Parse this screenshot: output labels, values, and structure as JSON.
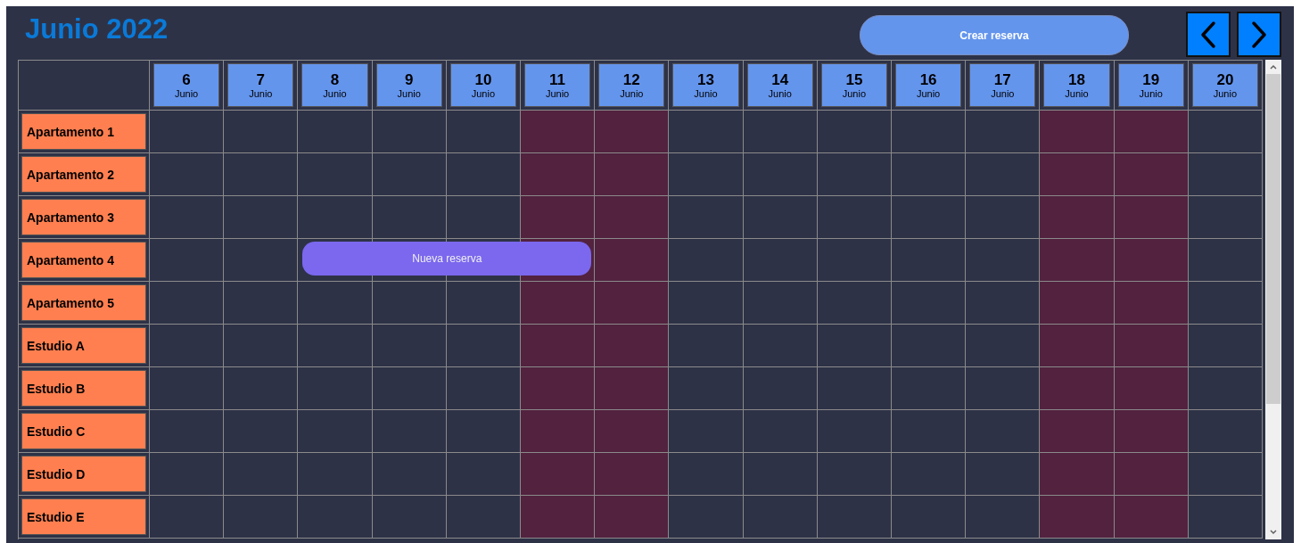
{
  "title": "Junio 2022",
  "create_button": "Crear reserva",
  "days": [
    {
      "day": "6",
      "month": "Junio",
      "weekend": false
    },
    {
      "day": "7",
      "month": "Junio",
      "weekend": false
    },
    {
      "day": "8",
      "month": "Junio",
      "weekend": false
    },
    {
      "day": "9",
      "month": "Junio",
      "weekend": false
    },
    {
      "day": "10",
      "month": "Junio",
      "weekend": false
    },
    {
      "day": "11",
      "month": "Junio",
      "weekend": true
    },
    {
      "day": "12",
      "month": "Junio",
      "weekend": true
    },
    {
      "day": "13",
      "month": "Junio",
      "weekend": false
    },
    {
      "day": "14",
      "month": "Junio",
      "weekend": false
    },
    {
      "day": "15",
      "month": "Junio",
      "weekend": false
    },
    {
      "day": "16",
      "month": "Junio",
      "weekend": false
    },
    {
      "day": "17",
      "month": "Junio",
      "weekend": false
    },
    {
      "day": "18",
      "month": "Junio",
      "weekend": true
    },
    {
      "day": "19",
      "month": "Junio",
      "weekend": true
    },
    {
      "day": "20",
      "month": "Junio",
      "weekend": false
    }
  ],
  "units": [
    "Apartamento 1",
    "Apartamento 2",
    "Apartamento 3",
    "Apartamento 4",
    "Apartamento 5",
    "Estudio A",
    "Estudio B",
    "Estudio C",
    "Estudio D",
    "Estudio E"
  ],
  "reservations": [
    {
      "label": "Nueva reserva"
    }
  ]
}
